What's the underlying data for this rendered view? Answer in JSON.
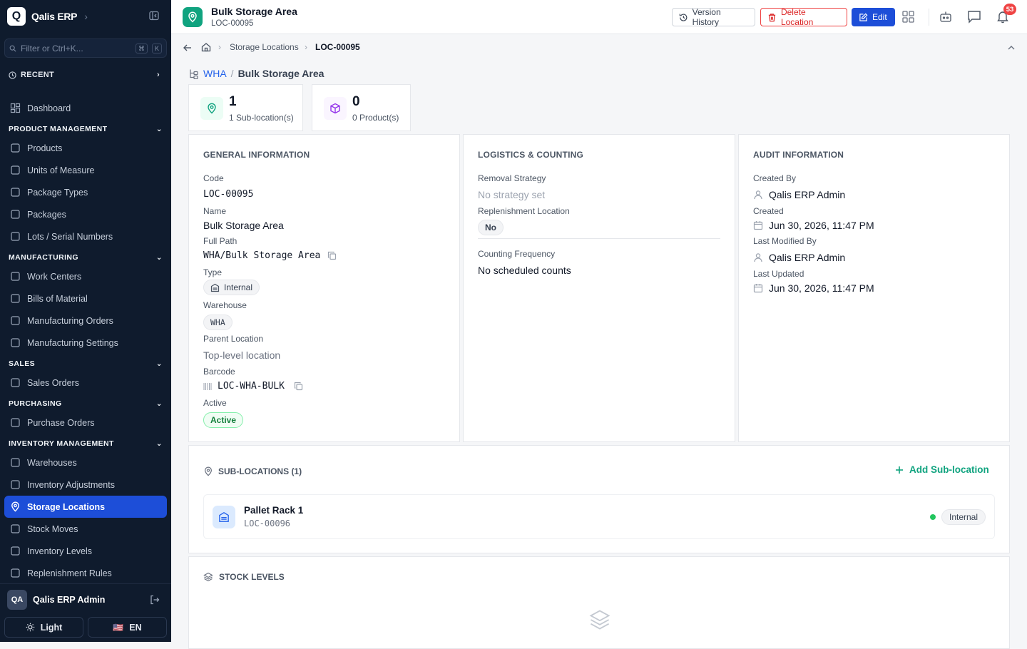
{
  "app": {
    "name": "Qalis ERP"
  },
  "sidebar": {
    "filter_placeholder": "Filter or Ctrl+K...",
    "kbd1": "⌘",
    "kbd2": "K",
    "recent": "RECENT",
    "dashboard": "Dashboard",
    "sections": [
      {
        "title": "PRODUCT MANAGEMENT",
        "items": [
          "Products",
          "Units of Measure",
          "Package Types",
          "Packages",
          "Lots / Serial Numbers"
        ]
      },
      {
        "title": "MANUFACTURING",
        "items": [
          "Work Centers",
          "Bills of Material",
          "Manufacturing Orders",
          "Manufacturing Settings"
        ]
      },
      {
        "title": "SALES",
        "items": [
          "Sales Orders"
        ]
      },
      {
        "title": "PURCHASING",
        "items": [
          "Purchase Orders"
        ]
      },
      {
        "title": "INVENTORY MANAGEMENT",
        "items": [
          "Warehouses",
          "Inventory Adjustments",
          "Storage Locations",
          "Stock Moves",
          "Inventory Levels",
          "Replenishment Rules"
        ]
      }
    ],
    "active_item": "Storage Locations",
    "user": {
      "initials": "QA",
      "name": "Qalis ERP Admin"
    },
    "theme_label": "Light",
    "lang_label": "EN",
    "lang_flag": "🇺🇸"
  },
  "header": {
    "title": "Bulk Storage Area",
    "subtitle": "LOC-00095",
    "version_history": "Version History",
    "delete": "Delete Location",
    "edit": "Edit",
    "notifications_count": "53"
  },
  "breadcrumb": {
    "parent": "Storage Locations",
    "current": "LOC-00095"
  },
  "path": {
    "warehouse": "WHA",
    "separator": "/",
    "name": "Bulk Storage Area"
  },
  "stats": {
    "sublocations_value": "1",
    "sublocations_label": "1 Sub-location(s)",
    "products_value": "0",
    "products_label": "0 Product(s)"
  },
  "general": {
    "heading": "GENERAL INFORMATION",
    "code_label": "Code",
    "code": "LOC-00095",
    "name_label": "Name",
    "name": "Bulk Storage Area",
    "full_path_label": "Full Path",
    "full_path": "WHA/Bulk Storage Area",
    "type_label": "Type",
    "type": "Internal",
    "warehouse_label": "Warehouse",
    "warehouse": "WHA",
    "parent_label": "Parent Location",
    "parent": "Top-level location",
    "barcode_label": "Barcode",
    "barcode": "LOC-WHA-BULK",
    "active_label": "Active",
    "active": "Active"
  },
  "logistics": {
    "heading": "LOGISTICS & COUNTING",
    "removal_label": "Removal Strategy",
    "removal": "No strategy set",
    "replenish_label": "Replenishment Location",
    "replenish": "No",
    "counting_label": "Counting Frequency",
    "counting": "No scheduled counts"
  },
  "audit": {
    "heading": "AUDIT INFORMATION",
    "created_by_label": "Created By",
    "created_by": "Qalis ERP Admin",
    "created_label": "Created",
    "created": "Jun 30, 2026, 11:47 PM",
    "modified_by_label": "Last Modified By",
    "modified_by": "Qalis ERP Admin",
    "updated_label": "Last Updated",
    "updated": "Jun 30, 2026, 11:47 PM"
  },
  "sublocations": {
    "heading": "SUB-LOCATIONS (1)",
    "add": "Add Sub-location",
    "items": [
      {
        "name": "Pallet Rack 1",
        "code": "LOC-00096",
        "type": "Internal",
        "status_color": "#22c55e"
      }
    ]
  },
  "stock": {
    "heading": "STOCK LEVELS"
  },
  "colors": {
    "accent": "#1d4ed8",
    "brand": "#10a37f",
    "danger": "#ef4444",
    "sidebar": "#0f1b2d"
  }
}
